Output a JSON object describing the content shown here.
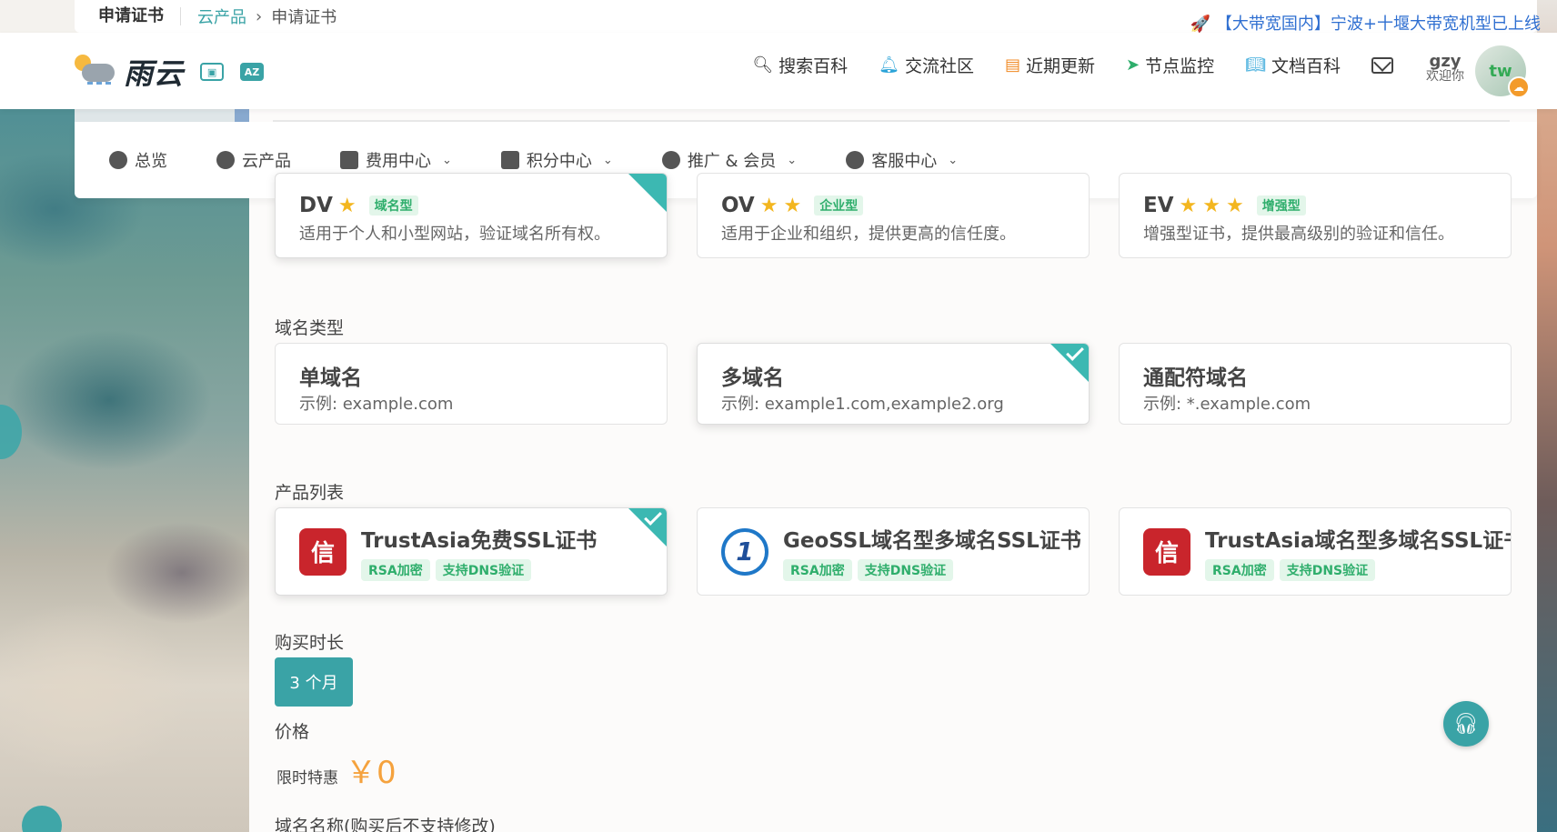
{
  "breadcrumb": {
    "title": "申请证书",
    "parent": "云产品",
    "separator": "›",
    "current": "申请证书"
  },
  "announcement": "【大带宽国内】宁波+十堰大带宽机型已上线",
  "header": {
    "logo_text": "雨云",
    "nav": [
      {
        "icon": "search-icon",
        "label": "搜索百科"
      },
      {
        "icon": "bell-icon",
        "label": "交流社区"
      },
      {
        "icon": "news-icon",
        "label": "近期更新"
      },
      {
        "icon": "paper-plane-icon",
        "label": "节点监控"
      },
      {
        "icon": "book-icon",
        "label": "文档百科"
      }
    ],
    "user": {
      "name": "gzy",
      "welcome": "欢迎你",
      "avatar_text": "tw"
    }
  },
  "menu": {
    "items": [
      {
        "label": "总览",
        "has_dropdown": false
      },
      {
        "label": "云产品",
        "has_dropdown": false
      },
      {
        "label": "费用中心",
        "has_dropdown": true
      },
      {
        "label": "积分中心",
        "has_dropdown": true
      },
      {
        "label": "推广 & 会员",
        "has_dropdown": true
      },
      {
        "label": "客服中心",
        "has_dropdown": true
      }
    ]
  },
  "validation_types": [
    {
      "code": "DV",
      "stars": 1,
      "tag": "域名型",
      "desc": "适用于个人和小型网站，验证域名所有权。",
      "selected": true
    },
    {
      "code": "OV",
      "stars": 2,
      "tag": "企业型",
      "desc": "适用于企业和组织，提供更高的信任度。",
      "selected": false
    },
    {
      "code": "EV",
      "stars": 3,
      "tag": "增强型",
      "desc": "增强型证书，提供最高级别的验证和信任。",
      "selected": false
    }
  ],
  "domain_section": {
    "label": "域名类型",
    "options": [
      {
        "title": "单域名",
        "desc": "示例: example.com",
        "selected": false
      },
      {
        "title": "多域名",
        "desc": "示例: example1.com,example2.org",
        "selected": true
      },
      {
        "title": "通配符域名",
        "desc": "示例: *.example.com",
        "selected": false
      }
    ]
  },
  "product_section": {
    "label": "产品列表",
    "products": [
      {
        "name": "TrustAsia免费SSL证书",
        "logo": "trustasia-logo",
        "tags": [
          "RSA加密",
          "支持DNS验证"
        ],
        "selected": true
      },
      {
        "name": "GeoSSL域名型多域名SSL证书",
        "logo": "geossl-logo",
        "tags": [
          "RSA加密",
          "支持DNS验证"
        ],
        "selected": false
      },
      {
        "name": "TrustAsia域名型多域名SSL证书",
        "logo": "trustasia-logo",
        "tags": [
          "RSA加密",
          "支持DNS验证"
        ],
        "selected": false
      }
    ]
  },
  "duration": {
    "label": "购买时长",
    "option": "3 个月"
  },
  "price": {
    "label": "价格",
    "promo_label": "限时特惠",
    "value": "￥0"
  },
  "domain_name": {
    "label": "域名名称(购买后不支持修改)"
  },
  "colors": {
    "accent": "#3aa3a6",
    "price": "#f5a23d",
    "tag_green": "#2fae6c",
    "check": "#3cb8b2"
  }
}
